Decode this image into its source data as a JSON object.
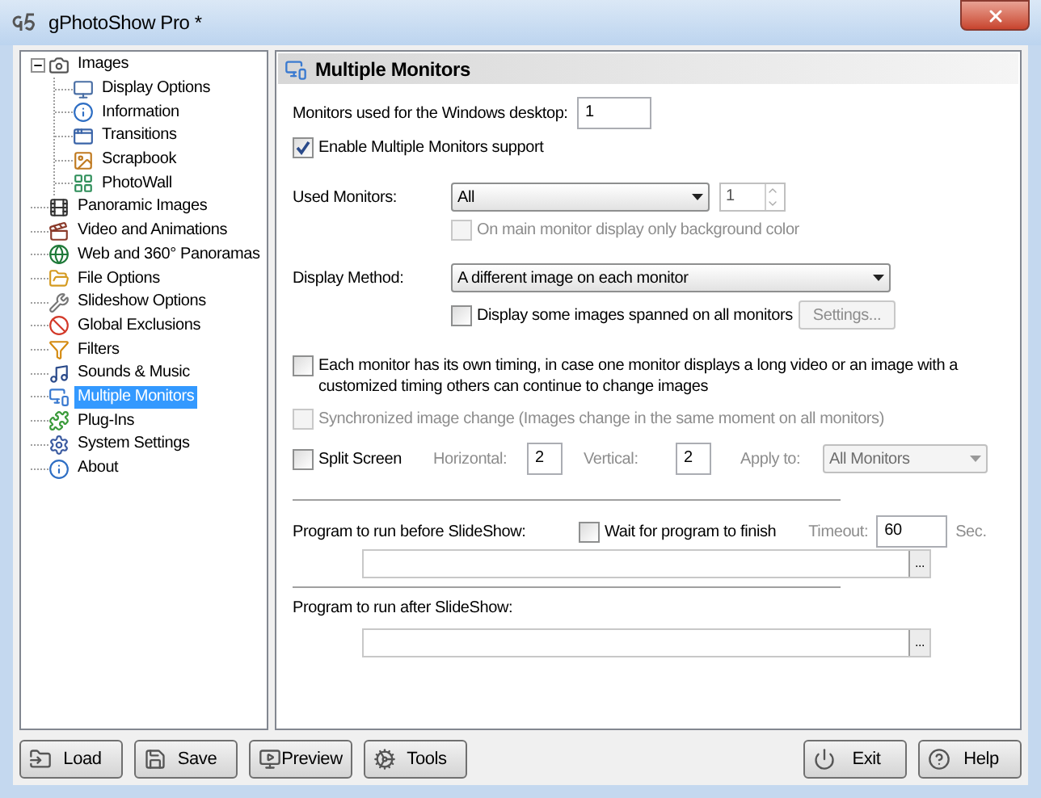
{
  "window": {
    "title": "gPhotoShow Pro *"
  },
  "tree": [
    {
      "label": "Images",
      "kind": "camera",
      "selected": false,
      "expanded": true,
      "children": [
        {
          "label": "Display Options",
          "kind": "monitor",
          "selected": false
        },
        {
          "label": "Information",
          "kind": "info",
          "selected": false
        },
        {
          "label": "Transitions",
          "kind": "window",
          "selected": false
        },
        {
          "label": "Scrapbook",
          "kind": "photo",
          "selected": false
        },
        {
          "label": "PhotoWall",
          "kind": "grid",
          "selected": false
        }
      ]
    },
    {
      "label": "Panoramic Images",
      "kind": "film",
      "selected": false
    },
    {
      "label": "Video and Animations",
      "kind": "reel",
      "selected": false
    },
    {
      "label": "Web and 360° Panoramas",
      "kind": "globe",
      "selected": false
    },
    {
      "label": "File Options",
      "kind": "folder",
      "selected": false
    },
    {
      "label": "Slideshow Options",
      "kind": "tools",
      "selected": false
    },
    {
      "label": "Global Exclusions",
      "kind": "ban",
      "selected": false
    },
    {
      "label": "Filters",
      "kind": "filter",
      "selected": false
    },
    {
      "label": "Sounds & Music",
      "kind": "music",
      "selected": false
    },
    {
      "label": "Multiple Monitors",
      "kind": "monitors",
      "selected": true
    },
    {
      "label": "Plug-Ins",
      "kind": "puzzle",
      "selected": false
    },
    {
      "label": "System Settings",
      "kind": "settings",
      "selected": false
    },
    {
      "label": "About",
      "kind": "info",
      "selected": false
    }
  ],
  "panel": {
    "title": "Multiple Monitors",
    "desktop_monitors": {
      "label": "Monitors used for the Windows desktop:",
      "value": "1"
    },
    "enable_multiple": {
      "label": "Enable Multiple Monitors support",
      "checked": true,
      "disabled": false
    },
    "used_monitors": {
      "label": "Used Monitors:",
      "value": "All",
      "spin_value": "1"
    },
    "background_only": {
      "label": "On main monitor display only background color",
      "checked": false,
      "disabled": true
    },
    "display_method": {
      "label": "Display Method:",
      "value": "A different image on each monitor"
    },
    "spanned": {
      "label": "Display some images spanned on all monitors",
      "checked": false,
      "disabled": false
    },
    "settings_button": {
      "label": "Settings...",
      "disabled": true
    },
    "own_timing": {
      "label": "Each monitor has its own timing, in case one monitor displays a long video or an image with a customized timing others can continue to change images",
      "checked": false,
      "disabled": false
    },
    "synchronized": {
      "label": "Synchronized image change (Images change in the same moment on all monitors)",
      "checked": false,
      "disabled": true
    },
    "split_screen": {
      "label": "Split Screen",
      "checked": false,
      "disabled": false,
      "horizontal_label": "Horizontal:",
      "horizontal": "2",
      "vertical_label": "Vertical:",
      "vertical": "2",
      "apply_label": "Apply to:",
      "apply_value": "All Monitors"
    },
    "before": {
      "label": "Program to run before SlideShow:",
      "wait_label": "Wait for program to finish",
      "wait_checked": false,
      "timeout_label": "Timeout:",
      "timeout": "60",
      "unit": "Sec.",
      "browse": "..."
    },
    "after": {
      "label": "Program to run after SlideShow:",
      "browse": "..."
    }
  },
  "buttons_left": [
    {
      "label": "Load",
      "kind": "load"
    },
    {
      "label": "Save",
      "kind": "save"
    },
    {
      "label": "Preview",
      "kind": "preview"
    },
    {
      "label": "Tools",
      "kind": "tools"
    }
  ],
  "buttons_right": [
    {
      "label": "Exit",
      "kind": "exit"
    },
    {
      "label": "Help",
      "kind": "help"
    }
  ]
}
